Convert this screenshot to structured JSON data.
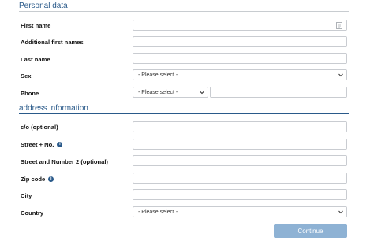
{
  "personal": {
    "title": "Personal data",
    "first_name_label": "First name",
    "additional_first_names_label": "Additional first names",
    "last_name_label": "Last name",
    "sex_label": "Sex",
    "sex_value": "- Please select -",
    "phone_label": "Phone",
    "phone_code_value": "- Please select -"
  },
  "address": {
    "title": "address information",
    "co_label": "c/o (optional)",
    "street_label": "Street + No.",
    "street2_label": "Street and Number 2 (optional)",
    "zip_label": "Zip code",
    "city_label": "City",
    "country_label": "Country",
    "country_value": "- Please select -"
  },
  "actions": {
    "continue_label": "Continue"
  },
  "colors": {
    "accent": "#2a5a8a",
    "button": "#8eb2d4"
  }
}
